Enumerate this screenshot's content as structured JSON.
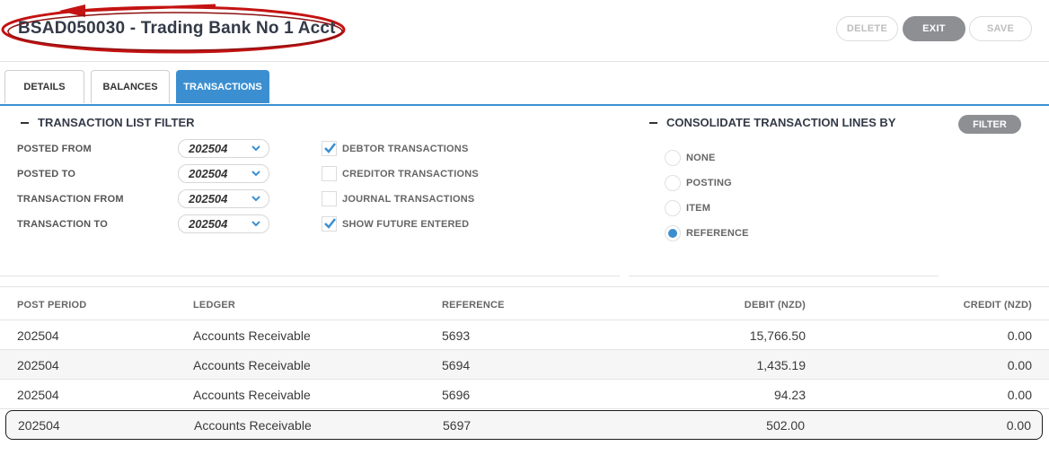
{
  "header": {
    "title": "BSAD050030 - Trading Bank No 1 Acct",
    "buttons": {
      "delete": "DELETE",
      "exit": "EXIT",
      "save": "SAVE"
    }
  },
  "tabs": [
    {
      "label": "DETAILS",
      "active": false
    },
    {
      "label": "BALANCES",
      "active": false
    },
    {
      "label": "TRANSACTIONS",
      "active": true
    }
  ],
  "filter": {
    "title": "TRANSACTION LIST FILTER",
    "fields": [
      {
        "label": "POSTED FROM",
        "value": "202504"
      },
      {
        "label": "POSTED TO",
        "value": "202504"
      },
      {
        "label": "TRANSACTION FROM",
        "value": "202504"
      },
      {
        "label": "TRANSACTION TO",
        "value": "202504"
      }
    ],
    "checkboxes": [
      {
        "label": "DEBTOR TRANSACTIONS",
        "checked": true
      },
      {
        "label": "CREDITOR TRANSACTIONS",
        "checked": false
      },
      {
        "label": "JOURNAL TRANSACTIONS",
        "checked": false
      },
      {
        "label": "SHOW FUTURE ENTERED",
        "checked": true
      }
    ]
  },
  "consolidate": {
    "title": "CONSOLIDATE TRANSACTION LINES BY",
    "filter_button": "FILTER",
    "options": [
      {
        "label": "NONE",
        "selected": false
      },
      {
        "label": "POSTING",
        "selected": false
      },
      {
        "label": "ITEM",
        "selected": false
      },
      {
        "label": "REFERENCE",
        "selected": true
      }
    ]
  },
  "table": {
    "columns": [
      "POST PERIOD",
      "LEDGER",
      "REFERENCE",
      "DEBIT (NZD)",
      "CREDIT (NZD)"
    ],
    "rows": [
      {
        "period": "202504",
        "ledger": "Accounts Receivable",
        "reference": "5693",
        "debit": "15,766.50",
        "credit": "0.00"
      },
      {
        "period": "202504",
        "ledger": "Accounts Receivable",
        "reference": "5694",
        "debit": "1,435.19",
        "credit": "0.00"
      },
      {
        "period": "202504",
        "ledger": "Accounts Receivable",
        "reference": "5696",
        "debit": "94.23",
        "credit": "0.00"
      },
      {
        "period": "202504",
        "ledger": "Accounts Receivable",
        "reference": "5697",
        "debit": "502.00",
        "credit": "0.00"
      }
    ]
  },
  "colors": {
    "accent": "#3b8fd1",
    "annotation": "#c41212",
    "button_gray": "#8d8f93"
  }
}
